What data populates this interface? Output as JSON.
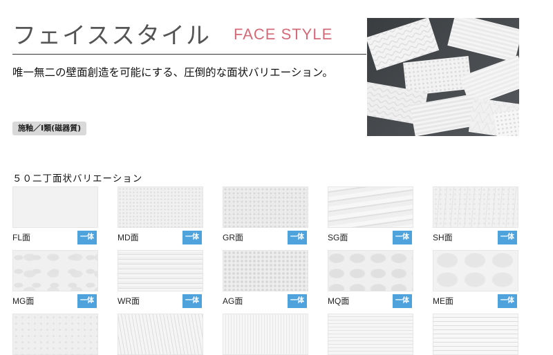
{
  "header": {
    "title_jp": "フェイススタイル",
    "title_en": "FACE STYLE",
    "tagline": "唯一無二の壁面創造を可能にする、圧倒的な面状バリエーション。",
    "badge": "施釉／Ⅰ類(磁器質)"
  },
  "colors": {
    "accent_pink": "#d46a78",
    "mark_blue": "#4fa3dd",
    "badge_gray": "#d9d9d9"
  },
  "hero": {
    "icon": "tile-samples-photo"
  },
  "section": {
    "title": "５０二丁面状バリエーション"
  },
  "tiles": [
    {
      "label": "FL面",
      "mark": "一体",
      "texture": "flat"
    },
    {
      "label": "MD面",
      "mark": "一体",
      "texture": "fine-dot"
    },
    {
      "label": "GR面",
      "mark": "一体",
      "texture": "granular"
    },
    {
      "label": "SG面",
      "mark": "一体",
      "texture": "stratum"
    },
    {
      "label": "SH面",
      "mark": "一体",
      "texture": "split-hewn"
    },
    {
      "label": "MG面",
      "mark": "一体",
      "texture": "mottled"
    },
    {
      "label": "WR面",
      "mark": "一体",
      "texture": "wave-ridge"
    },
    {
      "label": "AG面",
      "mark": "一体",
      "texture": "aggregate"
    },
    {
      "label": "MQ面",
      "mark": "一体",
      "texture": "rock"
    },
    {
      "label": "ME面",
      "mark": "一体",
      "texture": "soft-relief"
    },
    {
      "label": "",
      "mark": "",
      "texture": "dotted"
    },
    {
      "label": "",
      "mark": "",
      "texture": "chisel"
    },
    {
      "label": "",
      "mark": "",
      "texture": "fine-vertical"
    },
    {
      "label": "",
      "mark": "",
      "texture": "fine-horizontal"
    },
    {
      "label": "",
      "mark": "",
      "texture": "ribbed"
    }
  ]
}
